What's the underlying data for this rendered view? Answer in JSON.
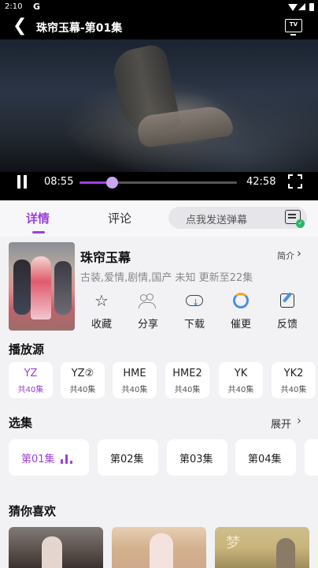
{
  "status_bar": {
    "time": "2:10",
    "app_glyph": "G"
  },
  "player": {
    "title": "珠帘玉幕-第01集",
    "tv_label": "TV",
    "current_time": "08:55",
    "duration": "42:58",
    "progress_fraction": 0.207,
    "accent": "#a23fe0"
  },
  "tabs": [
    {
      "label": "详情",
      "active": true
    },
    {
      "label": "评论",
      "active": false
    }
  ],
  "danmu": {
    "placeholder": "点我发送弹幕"
  },
  "show": {
    "title": "珠帘玉幕",
    "intro_label": "简介",
    "meta": "古装,爱情,剧情,国产  未知  更新至22集"
  },
  "actions": [
    {
      "label": "收藏",
      "icon": "star-icon"
    },
    {
      "label": "分享",
      "icon": "share-icon"
    },
    {
      "label": "下载",
      "icon": "download-icon"
    },
    {
      "label": "催更",
      "icon": "refresh-icon"
    },
    {
      "label": "反馈",
      "icon": "feedback-icon"
    }
  ],
  "sources": {
    "title": "播放源",
    "items": [
      {
        "name": "YZ",
        "episodes": "共40集",
        "active": true
      },
      {
        "name": "YZ②",
        "episodes": "共40集",
        "active": false
      },
      {
        "name": "HME",
        "episodes": "共40集",
        "active": false
      },
      {
        "name": "HME2",
        "episodes": "共40集",
        "active": false
      },
      {
        "name": "YK",
        "episodes": "共40集",
        "active": false
      },
      {
        "name": "YK2",
        "episodes": "共40集",
        "active": false
      }
    ]
  },
  "episodes": {
    "title": "选集",
    "expand_label": "展开",
    "items": [
      {
        "label": "第01集",
        "active": true
      },
      {
        "label": "第02集",
        "active": false
      },
      {
        "label": "第03集",
        "active": false
      },
      {
        "label": "第04集",
        "active": false
      }
    ]
  },
  "recommend": {
    "title": "猜你喜欢",
    "overlay_text": "梦"
  }
}
